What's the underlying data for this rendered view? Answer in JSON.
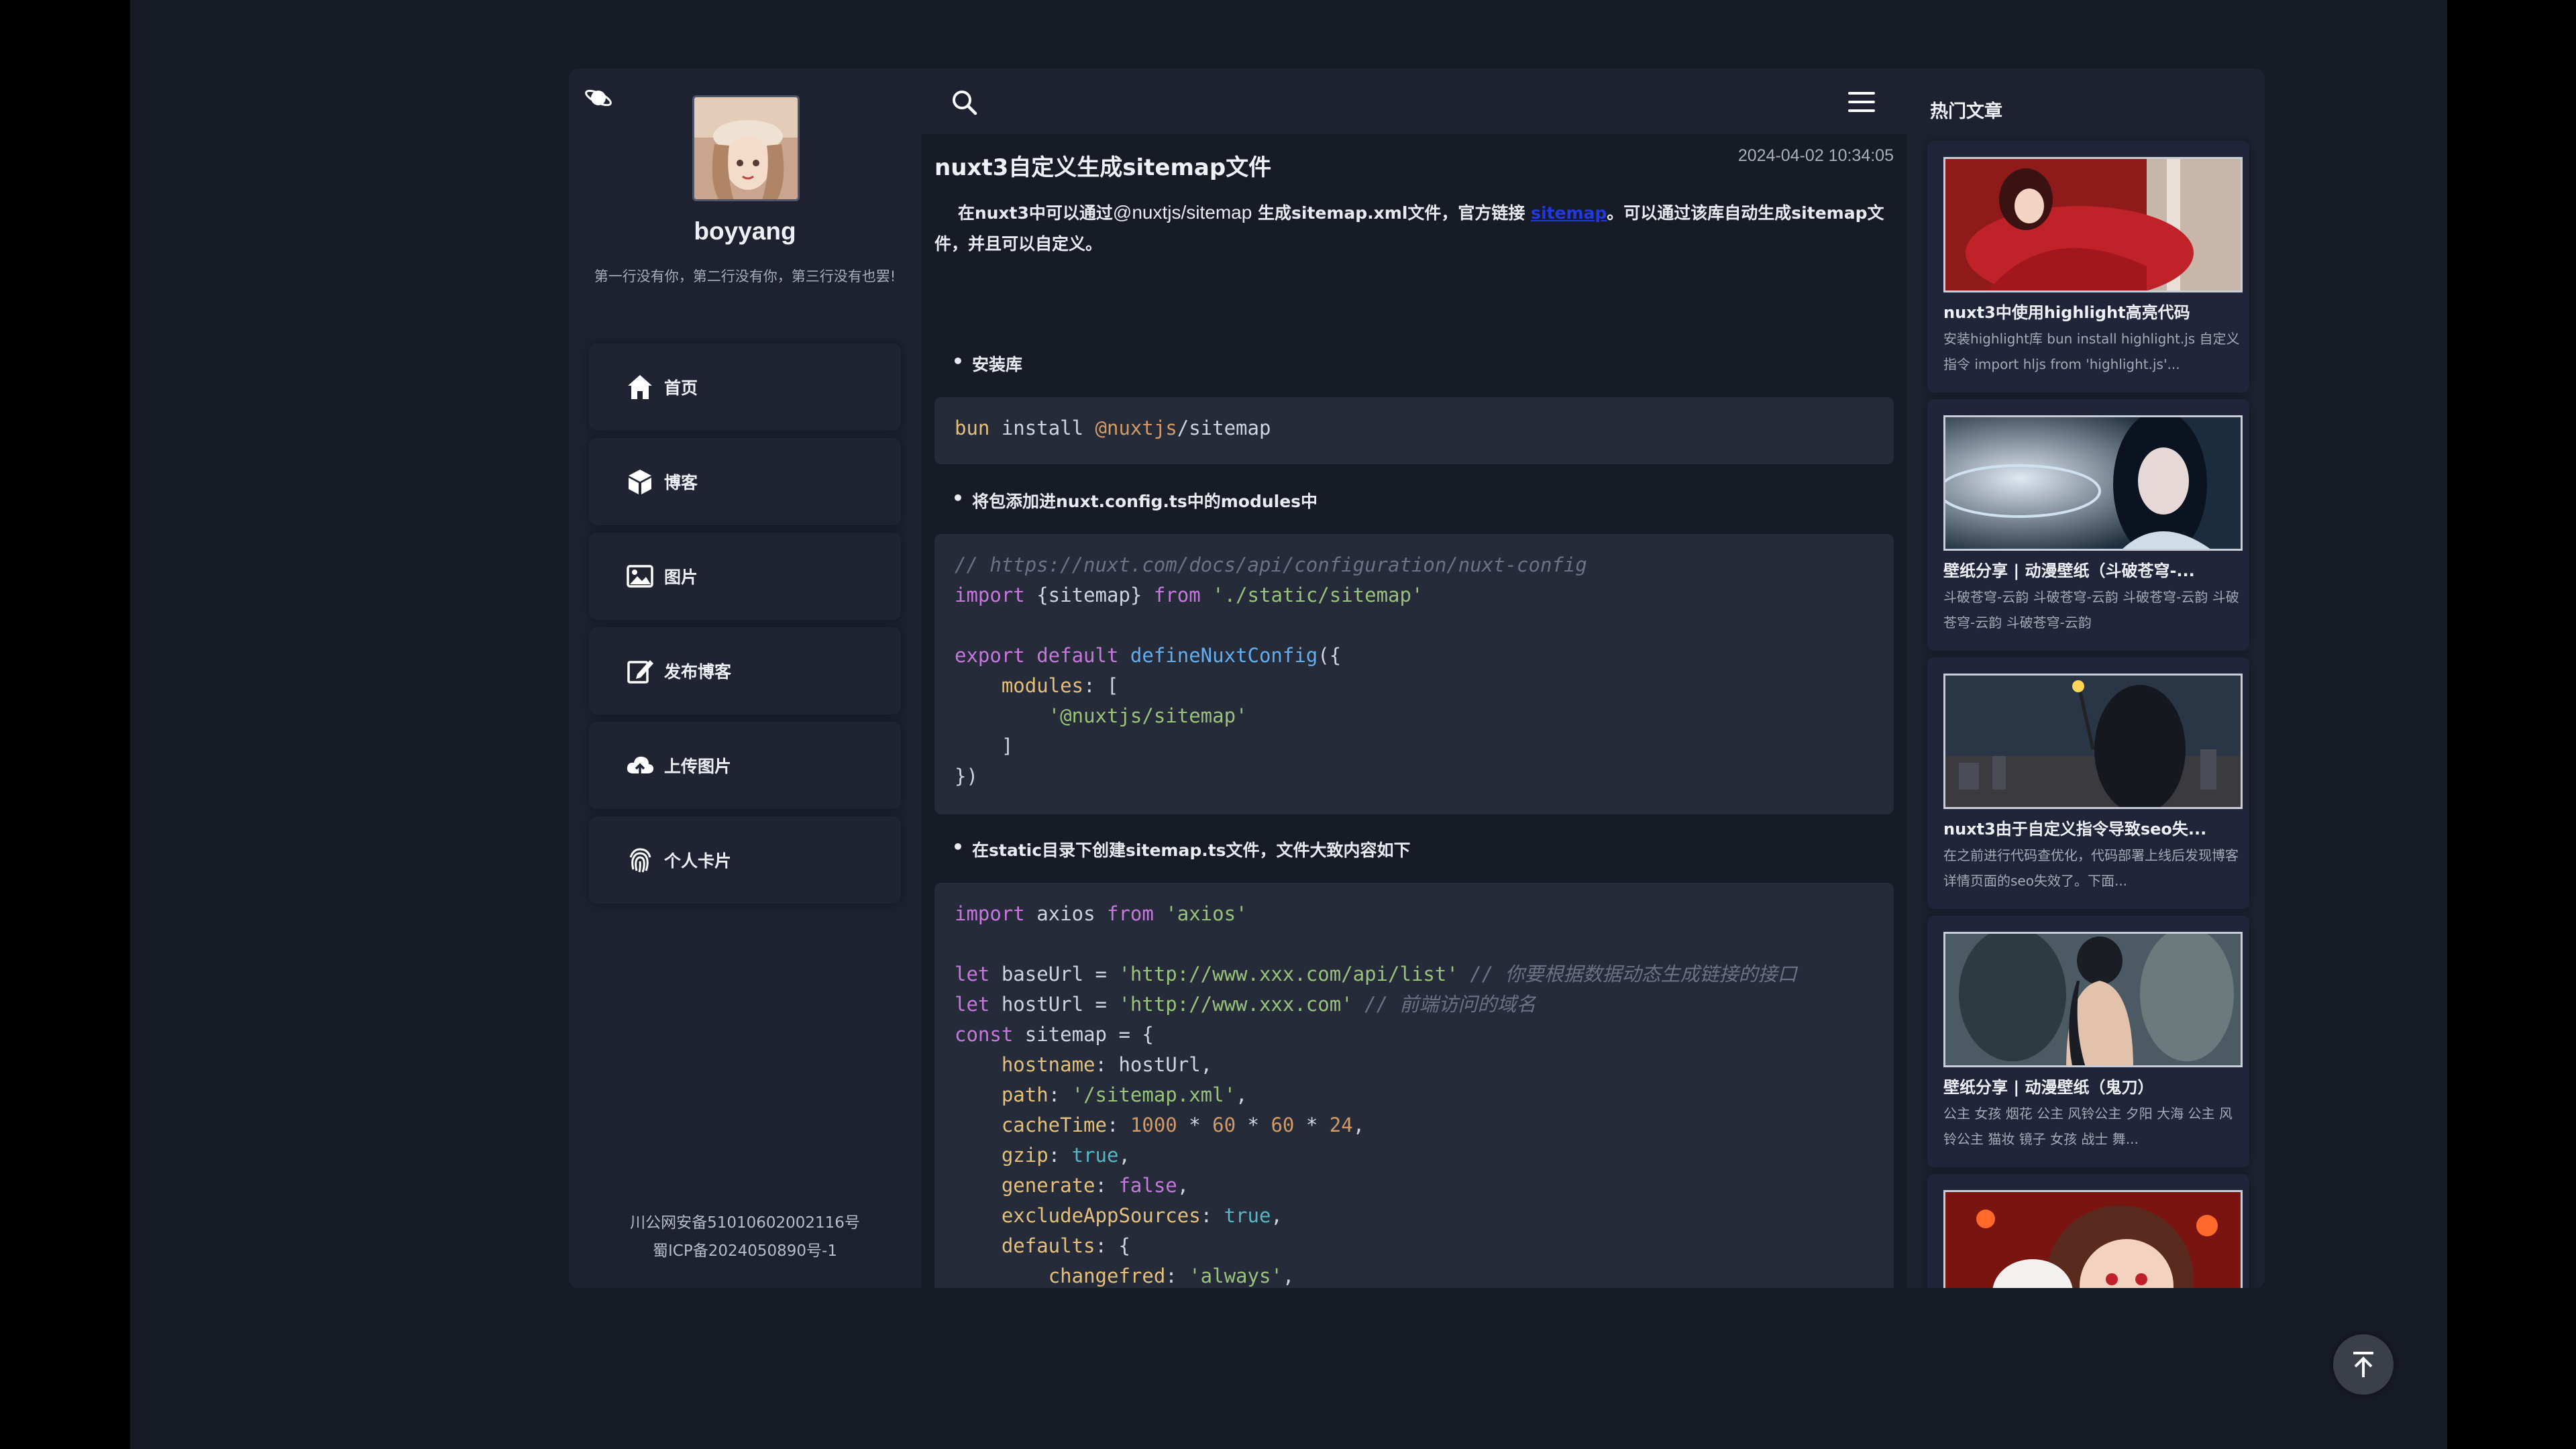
{
  "sidebar": {
    "username": "boyyang",
    "bio": "第一行没有你，第二行没有你，第三行没有也罢!",
    "items": [
      {
        "label": "首页",
        "icon": "home-icon"
      },
      {
        "label": "博客",
        "icon": "cube-icon"
      },
      {
        "label": "图片",
        "icon": "image-icon"
      },
      {
        "label": "发布博客",
        "icon": "edit-icon"
      },
      {
        "label": "上传图片",
        "icon": "cloud-upload-icon"
      },
      {
        "label": "个人卡片",
        "icon": "fingerprint-icon"
      }
    ],
    "icp_line1": "川公网安备51010602002116号",
    "icp_line2": "蜀ICP备2024050890号-1"
  },
  "topbar": {
    "search_icon": "search-icon",
    "menu_icon": "menu-icon"
  },
  "post": {
    "title": "nuxt3自定义生成sitemap文件",
    "date": "2024-04-02 10:34:05",
    "intro_a": "在nuxt3中可以通过",
    "intro_pkg": "@nuxtjs/sitemap",
    "intro_b": " 生成sitemap.xml文件，官方链接 ",
    "intro_link": "sitemap",
    "intro_c": "。可以通过该库自动生成sitemap文件，并且可以自定义。",
    "bullet1": "安装库",
    "code1": "bun install @nuxtjs/sitemap",
    "bullet2": "将包添加进nuxt.config.ts中的modules中",
    "bullet3": "在static目录下创建sitemap.ts文件，文件大致内容如下"
  },
  "right": {
    "title": "热门文章",
    "articles": [
      {
        "title": "nuxt3中使用highlight高亮代码",
        "desc": "安装highlight库 bun install highlight.js 自定义指令 import hljs from 'highlight.js'..."
      },
      {
        "title": "壁纸分享 | 动漫壁纸（斗破苍穹-...",
        "desc": "斗破苍穹-云韵 斗破苍穹-云韵 斗破苍穹-云韵 斗破苍穹-云韵 斗破苍穹-云韵"
      },
      {
        "title": "nuxt3由于自定义指令导致seo失...",
        "desc": "在之前进行代码查优化，代码部署上线后发现博客详情页面的seo失效了。下面..."
      },
      {
        "title": "壁纸分享 | 动漫壁纸（鬼刀）",
        "desc": "公主 女孩 烟花 公主 风铃公主 夕阳 大海 公主 风铃公主 猫妆 镜子 女孩 战士 舞..."
      },
      {
        "title": "",
        "desc": ""
      }
    ]
  },
  "colors": {
    "background": "#171b25",
    "panel": "#1d2130",
    "code_bg": "#262b3a",
    "link": "#2238e0"
  }
}
